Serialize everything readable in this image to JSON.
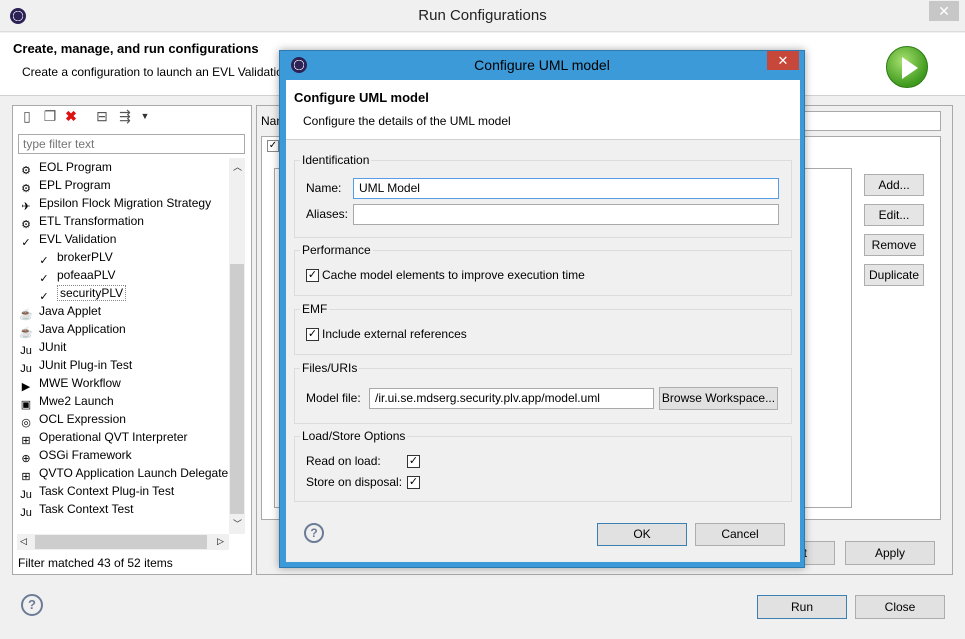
{
  "outer": {
    "title": "Run Configurations",
    "close_glyph": "✕",
    "header_title": "Create, manage, and run configurations",
    "header_desc": "Create a configuration to launch an EVL Validatio",
    "name_label_partial": "Nan",
    "buttons": {
      "apply": "Apply",
      "revert_partial": "t",
      "run": "Run",
      "close": "Close"
    },
    "side_buttons": [
      "Add...",
      "Edit...",
      "Remove",
      "Duplicate"
    ],
    "help_glyph": "?"
  },
  "left": {
    "filter_placeholder": "type filter text",
    "tree": [
      {
        "label": "EOL Program",
        "icon": "eol-icon",
        "glyph": "⚙",
        "indent": 0
      },
      {
        "label": "EPL Program",
        "icon": "epl-icon",
        "glyph": "⚙",
        "indent": 0
      },
      {
        "label": "Epsilon Flock Migration Strategy",
        "icon": "flock-icon",
        "glyph": "✈",
        "indent": 0
      },
      {
        "label": "ETL Transformation",
        "icon": "etl-icon",
        "glyph": "⚙",
        "indent": 0
      },
      {
        "label": "EVL Validation",
        "icon": "evl-icon",
        "glyph": "✓",
        "indent": 0
      },
      {
        "label": "brokerPLV",
        "icon": "evl-config-icon",
        "glyph": "✓",
        "indent": 1
      },
      {
        "label": "pofeaaPLV",
        "icon": "evl-config-icon",
        "glyph": "✓",
        "indent": 1
      },
      {
        "label": "securityPLV",
        "icon": "evl-config-icon",
        "glyph": "✓",
        "indent": 1,
        "selected": true
      },
      {
        "label": "Java Applet",
        "icon": "java-applet-icon",
        "glyph": "☕",
        "indent": 0
      },
      {
        "label": "Java Application",
        "icon": "java-app-icon",
        "glyph": "☕",
        "indent": 0
      },
      {
        "label": "JUnit",
        "icon": "junit-icon",
        "glyph": "Ju",
        "indent": 0
      },
      {
        "label": "JUnit Plug-in Test",
        "icon": "junit-plugin-icon",
        "glyph": "Ju",
        "indent": 0
      },
      {
        "label": "MWE Workflow",
        "icon": "mwe-icon",
        "glyph": "▶",
        "indent": 0
      },
      {
        "label": "Mwe2 Launch",
        "icon": "mwe2-icon",
        "glyph": "▣",
        "indent": 0
      },
      {
        "label": "OCL Expression",
        "icon": "ocl-icon",
        "glyph": "◎",
        "indent": 0
      },
      {
        "label": "Operational QVT Interpreter",
        "icon": "qvt-icon",
        "glyph": "⊞",
        "indent": 0
      },
      {
        "label": "OSGi Framework",
        "icon": "osgi-icon",
        "glyph": "⊕",
        "indent": 0
      },
      {
        "label": "QVTO Application Launch Delegate",
        "icon": "qvto-icon",
        "glyph": "⊞",
        "indent": 0
      },
      {
        "label": "Task Context Plug-in Test",
        "icon": "task-plugin-icon",
        "glyph": "Ju",
        "indent": 0
      },
      {
        "label": "Task Context Test",
        "icon": "task-test-icon",
        "glyph": "Ju",
        "indent": 0
      }
    ],
    "filter_status": "Filter matched 43 of 52 items"
  },
  "dialog": {
    "title": "Configure UML model",
    "close_glyph": "✕",
    "header_title": "Configure UML model",
    "header_desc": "Configure the details of the UML model",
    "identification": {
      "label": "Identification",
      "name_label": "Name:",
      "name_value": "UML Model",
      "aliases_label": "Aliases:",
      "aliases_value": ""
    },
    "performance": {
      "label": "Performance",
      "cache_label": "Cache model elements to improve execution time",
      "cache_checked": true
    },
    "emf": {
      "label": "EMF",
      "include_label": "Include external references",
      "include_checked": true
    },
    "files": {
      "label": "Files/URIs",
      "model_file_label": "Model file:",
      "model_file_value": "/ir.ui.se.mdserg.security.plv.app/model.uml",
      "browse_label": "Browse Workspace..."
    },
    "loadstore": {
      "label": "Load/Store Options",
      "read_label": "Read on load:",
      "read_checked": true,
      "store_label": "Store on disposal:",
      "store_checked": true
    },
    "ok_label": "OK",
    "cancel_label": "Cancel",
    "help_glyph": "?",
    "check_glyph": "✓"
  },
  "colors": {
    "dialog_frame": "#3c9ad8",
    "close_red": "#c7473a",
    "run_green": "#3f9a1e"
  }
}
